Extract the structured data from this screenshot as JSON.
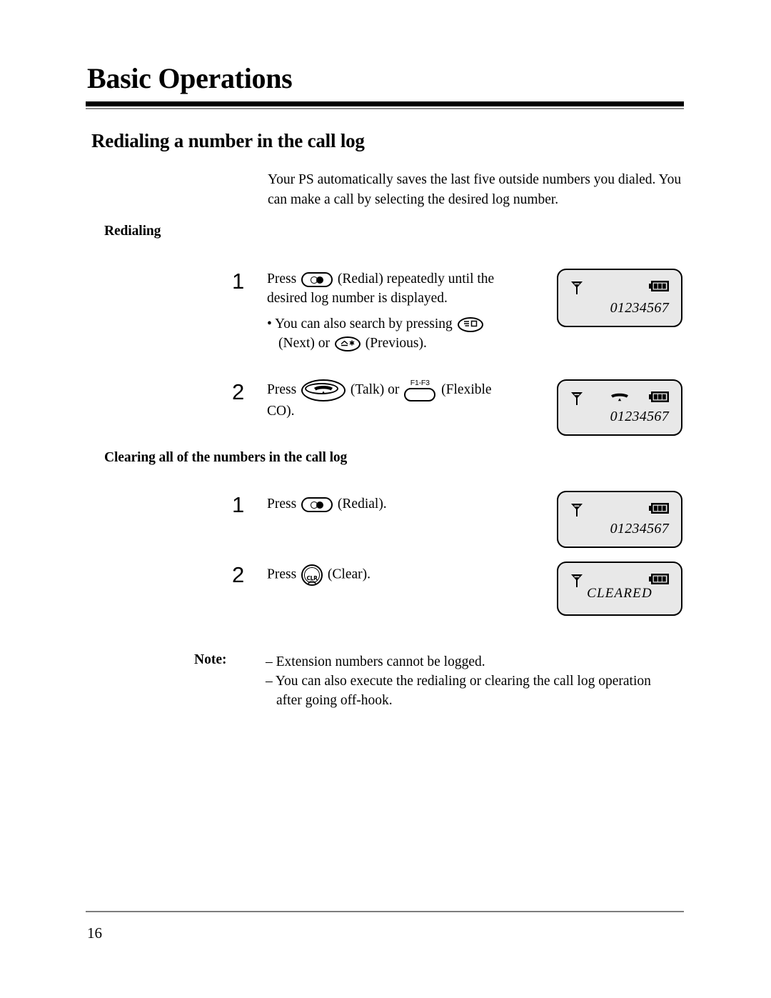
{
  "header": {
    "title": "Basic Operations",
    "section_title": "Redialing a number in the call log"
  },
  "intro": "Your PS automatically saves the last five outside numbers you dialed.  You can make a call by selecting the desired log number.",
  "redialing": {
    "heading": "Redialing",
    "steps": [
      {
        "number": "1",
        "text_before_key": "Press",
        "key": "redial-key",
        "text_after_key": "(Redial) repeatedly until the desired log number is displayed.",
        "bullet": {
          "prefix": "• You can also search by pressing",
          "key_next": "next-key",
          "middle": "(Next) or",
          "key_prev": "previous-key",
          "suffix": "(Previous)."
        }
      },
      {
        "number": "2",
        "text_before_key": "Press",
        "key": "talk-key",
        "middle": "(Talk) or",
        "key2": "flexible-co-key",
        "key2_label": "F1-F3",
        "text_after_key": "(Flexible CO)."
      }
    ]
  },
  "clearing": {
    "heading": "Clearing all of the numbers in the call log",
    "steps": [
      {
        "number": "1",
        "text_before_key": "Press",
        "key": "redial-key",
        "text_after_key": "(Redial)."
      },
      {
        "number": "2",
        "text_before_key": "Press",
        "key": "clear-key",
        "key_label": "CLR",
        "text_after_key": "(Clear)."
      }
    ]
  },
  "displays": [
    {
      "id": "display-redial-1",
      "antenna": "antenna-icon",
      "battery": "battery-full-icon",
      "handset": false,
      "text": "01234567",
      "align": "right"
    },
    {
      "id": "display-redial-2",
      "antenna": "antenna-icon",
      "battery": "battery-full-icon",
      "handset": true,
      "text": "01234567",
      "align": "right"
    },
    {
      "id": "display-clear-1",
      "antenna": "antenna-icon",
      "battery": "battery-full-icon",
      "handset": false,
      "text": "01234567",
      "align": "right"
    },
    {
      "id": "display-clear-2",
      "antenna": "antenna-icon",
      "battery": "battery-full-icon",
      "handset": false,
      "text": "CLEARED",
      "align": "center"
    }
  ],
  "note": {
    "label": "Note:",
    "items": [
      "– Extension numbers cannot be logged.",
      "– You can also execute the redialing or clearing the call log operation after going off-hook."
    ]
  },
  "footer": {
    "page_number": "16"
  }
}
